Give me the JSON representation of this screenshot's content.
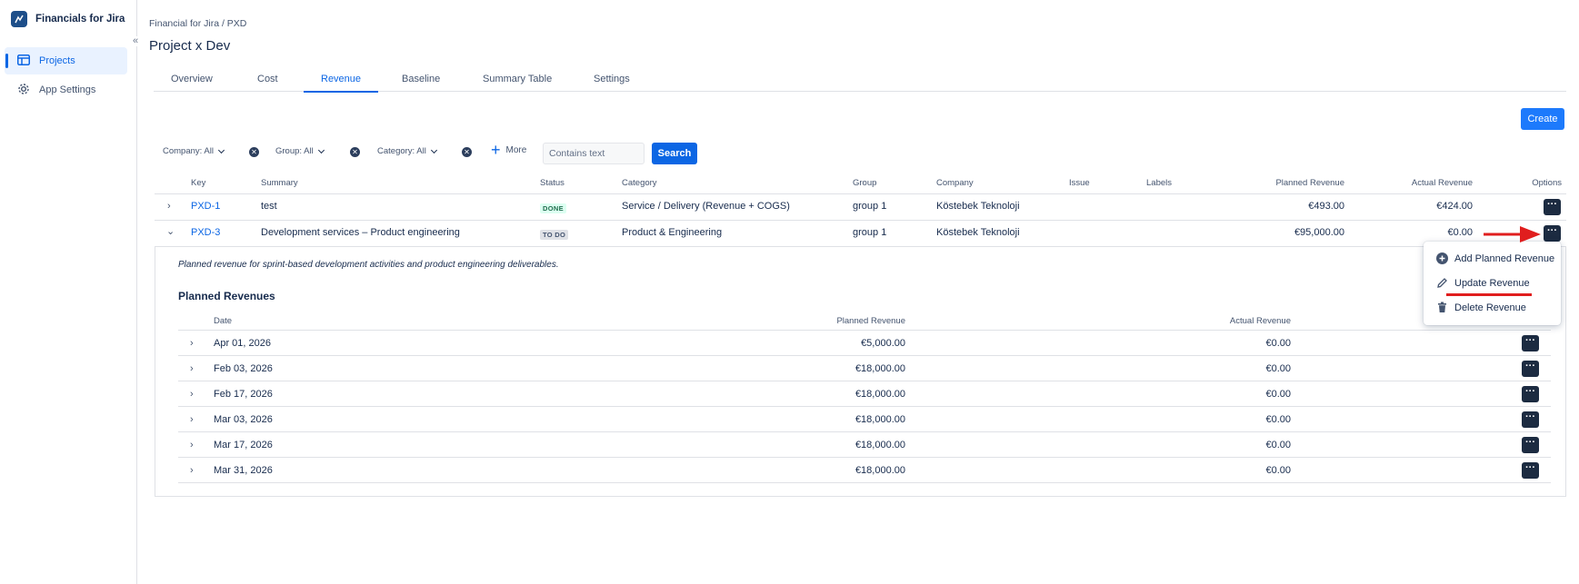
{
  "sidebar": {
    "app_title": "Financials for Jira",
    "collapse": "«",
    "items": [
      {
        "label": "Projects",
        "icon": "table-icon",
        "active": true
      },
      {
        "label": "App Settings",
        "icon": "gear-icon",
        "active": false
      }
    ]
  },
  "header": {
    "breadcrumb": "Financial for Jira  / PXD",
    "title": "Project x Dev"
  },
  "tabs": [
    "Overview",
    "Cost",
    "Revenue",
    "Baseline",
    "Summary Table",
    "Settings"
  ],
  "active_tab": "Revenue",
  "actions": {
    "create_label": "Create"
  },
  "filters": {
    "company": "Company: All",
    "group": "Group: All",
    "category": "Category: All",
    "more": "More",
    "search_placeholder": "Contains text",
    "search_label": "Search"
  },
  "table": {
    "columns": [
      "Key",
      "Summary",
      "Status",
      "Category",
      "Group",
      "Company",
      "Issue",
      "Labels",
      "Planned Revenue",
      "Actual Revenue",
      "Options"
    ],
    "rows": [
      {
        "key": "PXD-1",
        "summary": "test",
        "status": "DONE",
        "category": "Service / Delivery (Revenue + COGS)",
        "group": "group 1",
        "company": "Köstebek Teknoloji",
        "issue": "",
        "labels": "",
        "planned": "€493.00",
        "actual": "€424.00",
        "expand_icon": "›",
        "options": "···"
      },
      {
        "key": "PXD-3",
        "summary": "Development services – Product engineering",
        "status": "TO DO",
        "category": "Product & Engineering",
        "group": "group 1",
        "company": "Köstebek Teknoloji",
        "issue": "",
        "labels": "",
        "planned": "€95,000.00",
        "actual": "€0.00",
        "expand_icon": "⌄",
        "options": "···"
      }
    ]
  },
  "expanded": {
    "description": "Planned revenue for sprint-based development activities and product engineering deliverables.",
    "section_title": "Planned Revenues",
    "columns": [
      "Date",
      "Planned Revenue",
      "Actual Revenue"
    ],
    "rows": [
      {
        "date": "Apr 01, 2026",
        "planned": "€5,000.00",
        "actual": "€0.00",
        "expand_icon": "›",
        "options": "···"
      },
      {
        "date": "Feb 03, 2026",
        "planned": "€18,000.00",
        "actual": "€0.00",
        "expand_icon": "›",
        "options": "···"
      },
      {
        "date": "Feb 17, 2026",
        "planned": "€18,000.00",
        "actual": "€0.00",
        "expand_icon": "›",
        "options": "···"
      },
      {
        "date": "Mar 03, 2026",
        "planned": "€18,000.00",
        "actual": "€0.00",
        "expand_icon": "›",
        "options": "···"
      },
      {
        "date": "Mar 17, 2026",
        "planned": "€18,000.00",
        "actual": "€0.00",
        "expand_icon": "›",
        "options": "···"
      },
      {
        "date": "Mar 31, 2026",
        "planned": "€18,000.00",
        "actual": "€0.00",
        "expand_icon": "›",
        "options": "···"
      }
    ]
  },
  "menu": {
    "items": [
      {
        "label": "Add Planned Revenue",
        "icon": "plus-circle-icon"
      },
      {
        "label": "Update Revenue",
        "icon": "pencil-icon"
      },
      {
        "label": "Delete Revenue",
        "icon": "trash-icon"
      }
    ]
  },
  "colors": {
    "accent": "#0c66e4",
    "create_button": "#1d7afc",
    "options_button": "#1c2b41",
    "annotation": "#e01e1e"
  }
}
